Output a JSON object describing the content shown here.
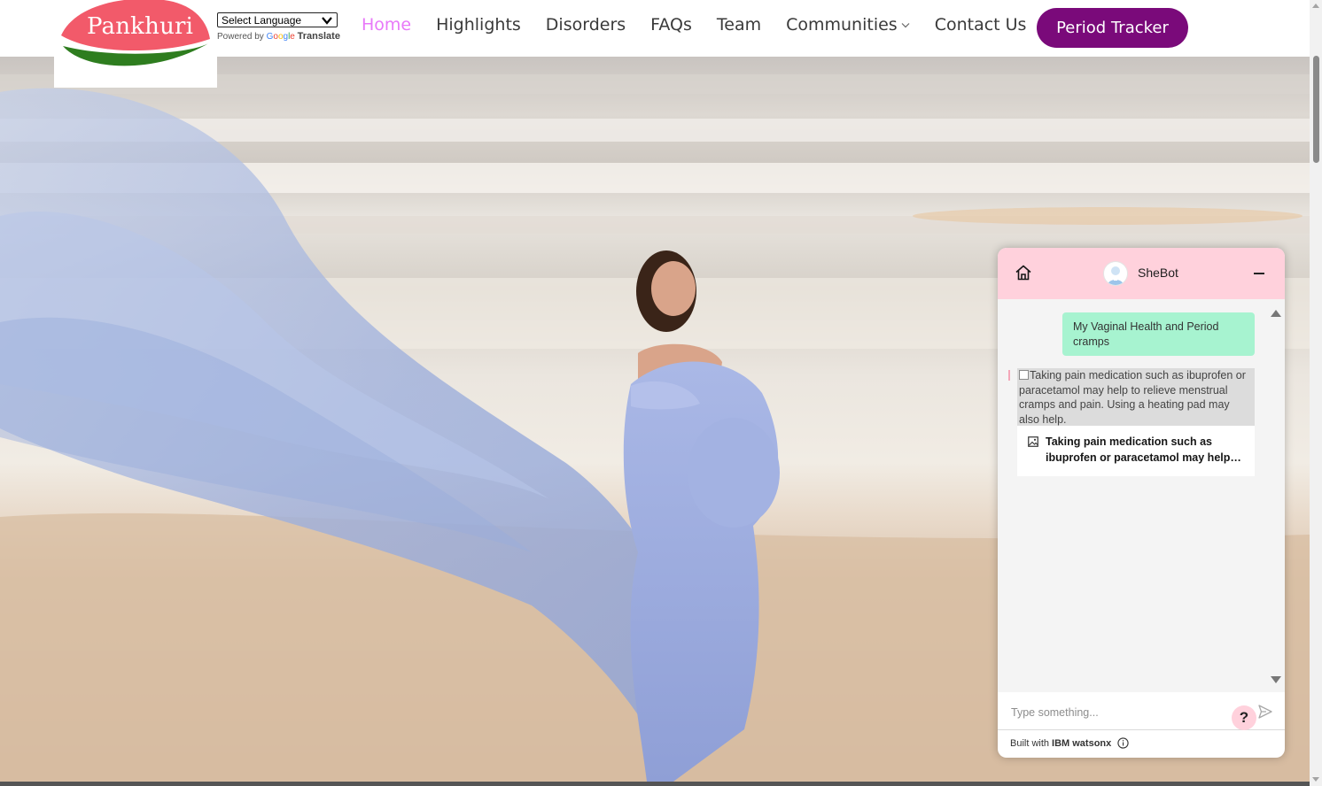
{
  "brand": {
    "logo_text": "Pankhuri"
  },
  "translate": {
    "select_label": "Select Language",
    "powered_by": "Powered by",
    "google": [
      "G",
      "o",
      "o",
      "g",
      "l",
      "e"
    ],
    "translate_word": "Translate"
  },
  "nav": {
    "items": [
      {
        "label": "Home",
        "active": true
      },
      {
        "label": "Highlights"
      },
      {
        "label": "Disorders"
      },
      {
        "label": "FAQs"
      },
      {
        "label": "Team"
      },
      {
        "label": "Communities",
        "dropdown": true
      },
      {
        "label": "Contact Us"
      }
    ],
    "cta": "Period Tracker"
  },
  "chat": {
    "bot_name": "SheBot",
    "user_message": "My Vaginal Health and Period cramps",
    "bot_message": "Taking pain medication such as ibuprofen or paracetamol may help to relieve menstrual cramps and pain. Using a heating pad may also help.",
    "card_text": "Taking pain medication such as ibuprofen or paracetamol may help to relieve menstrual cramps and pain. Using a heating pad may also help.",
    "help_label": "?",
    "input_placeholder": "Type something...",
    "footer_prefix": "Built with",
    "footer_brand": "IBM watsonx"
  },
  "colors": {
    "accent_purple": "#7a0a7a",
    "nav_active": "#e879f9",
    "chat_header": "#ffd1dc",
    "user_bubble": "#a7f3d0"
  },
  "icons": [
    "home-icon",
    "minimize-icon",
    "bot-avatar-icon",
    "image-icon",
    "send-icon",
    "info-icon",
    "help-icon",
    "chevron-down-icon"
  ]
}
